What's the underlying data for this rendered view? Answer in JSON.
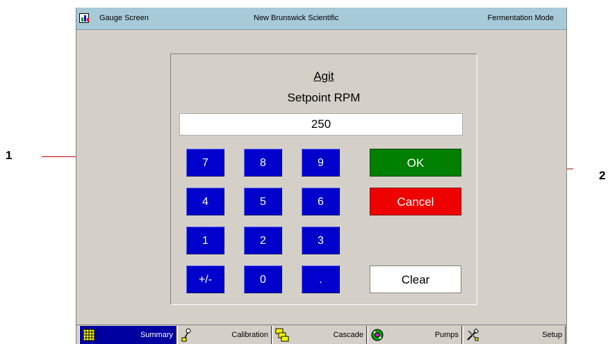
{
  "callouts": {
    "left_number": "1",
    "right_number": "2"
  },
  "titlebar": {
    "left": "Gauge Screen",
    "center": "New Brunswick Scientific",
    "right": "Fermentation Mode",
    "icon": "bar-chart-icon"
  },
  "dialog": {
    "title": "Agit",
    "subtitle": "Setpoint RPM",
    "value": "250",
    "keys": [
      "7",
      "8",
      "9",
      "4",
      "5",
      "6",
      "1",
      "2",
      "3",
      "+/-",
      "0",
      "."
    ],
    "ok_label": "OK",
    "cancel_label": "Cancel",
    "clear_label": "Clear"
  },
  "tabs": [
    {
      "label": "Summary",
      "icon": "grid-icon",
      "active": true
    },
    {
      "label": "Calibration",
      "icon": "probe-icon",
      "active": false
    },
    {
      "label": "Cascade",
      "icon": "cascade-icon",
      "active": false
    },
    {
      "label": "Pumps",
      "icon": "pump-icon",
      "active": false
    },
    {
      "label": "Setup",
      "icon": "tools-icon",
      "active": false
    }
  ],
  "colors": {
    "titlebar": "#a6cad8",
    "key_blue": "#0000cc",
    "ok_green": "#008000",
    "cancel_red": "#ee0000",
    "background": "#d4d0c8"
  }
}
